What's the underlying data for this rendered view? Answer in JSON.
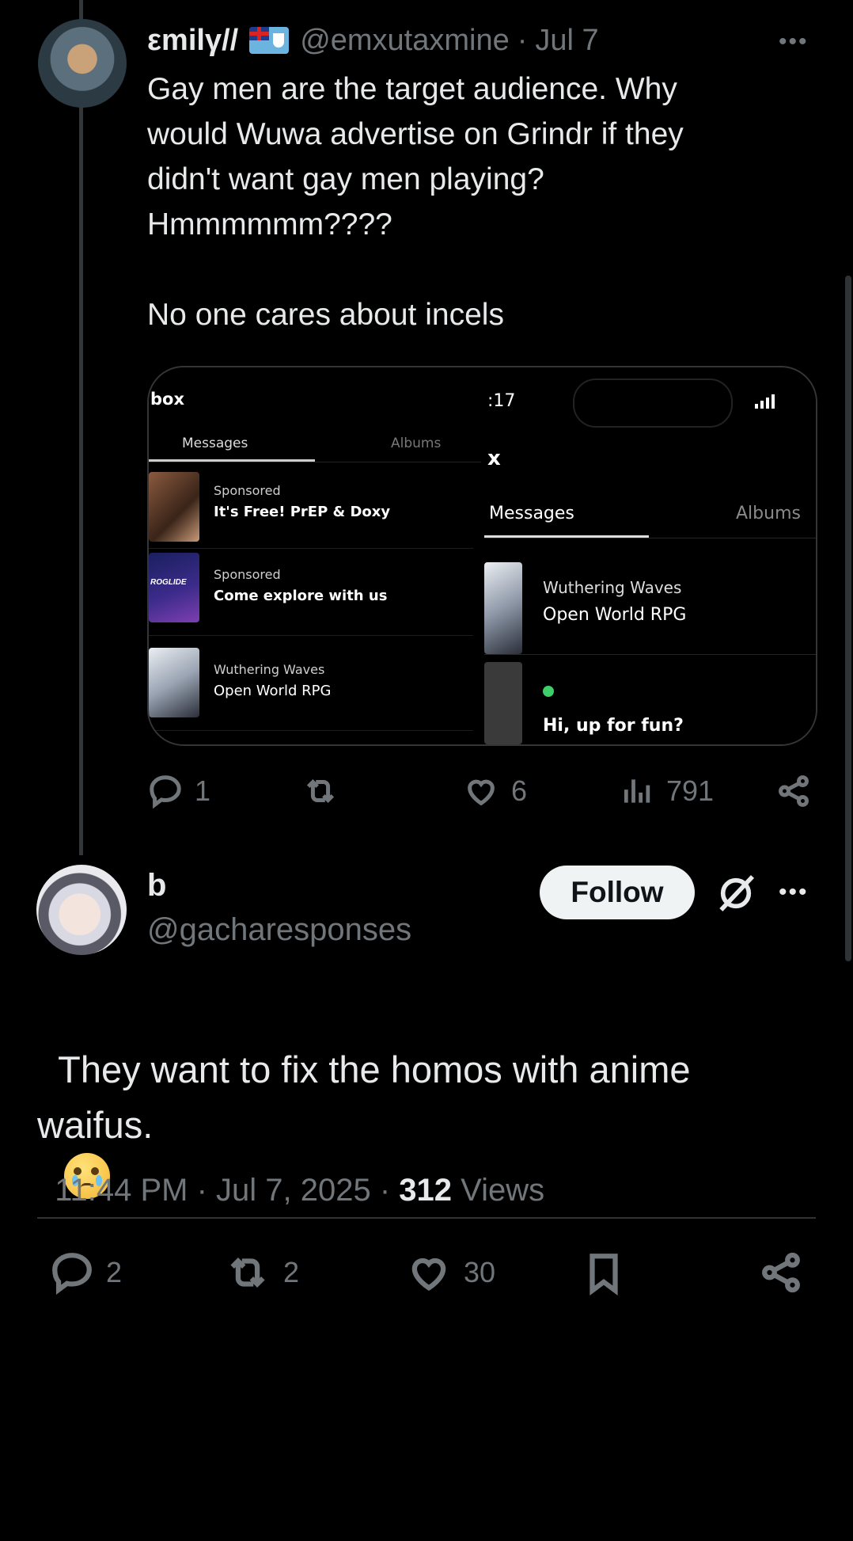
{
  "parent_post": {
    "display_name": "εmilγ//",
    "flag_icon": "fiji-flag",
    "handle": "@emxutaxmine",
    "separator": "·",
    "date": "Jul 7",
    "text": "Gay men are the target audience. Why\nwould Wuwa advertise on Grindr if they\ndidn't want gay men playing?\nHmmmmmm????\n\nNo one cares about incels",
    "media": {
      "left": {
        "header": "box",
        "tab_messages": "Messages",
        "tab_albums": "Albums",
        "rows": [
          {
            "tag": "Sponsored",
            "title": "It's Free! PrEP & Doxy"
          },
          {
            "tag": "Sponsored",
            "title": "Come explore with us",
            "brand": "ROGLIDE"
          },
          {
            "tag": "Wuthering Waves",
            "title": "Open World RPG"
          }
        ]
      },
      "right": {
        "time": ":17",
        "close": "x",
        "tab_messages": "Messages",
        "tab_albums": "Albums",
        "rows": [
          {
            "tag": "Wuthering Waves",
            "title": "Open World RPG"
          },
          {
            "tag": "",
            "title": "Hi, up for fun?"
          }
        ]
      }
    },
    "actions": {
      "replies": "1",
      "reposts": "",
      "likes": "6",
      "views": "791"
    }
  },
  "reply_post": {
    "display_name": "b",
    "handle": "@gacharesponses",
    "follow_label": "Follow",
    "text": "They want to fix the homos with anime\nwaifus.",
    "emoji": "😢",
    "timestamp": "11:44 PM · Jul 7, 2025 · ",
    "views_count": "312",
    "views_label": " Views",
    "actions": {
      "replies": "2",
      "reposts": "2",
      "likes": "30"
    }
  },
  "colors": {
    "background": "#000000",
    "text": "#e7e9ea",
    "muted": "#71767b",
    "follow_bg": "#eff3f4"
  }
}
